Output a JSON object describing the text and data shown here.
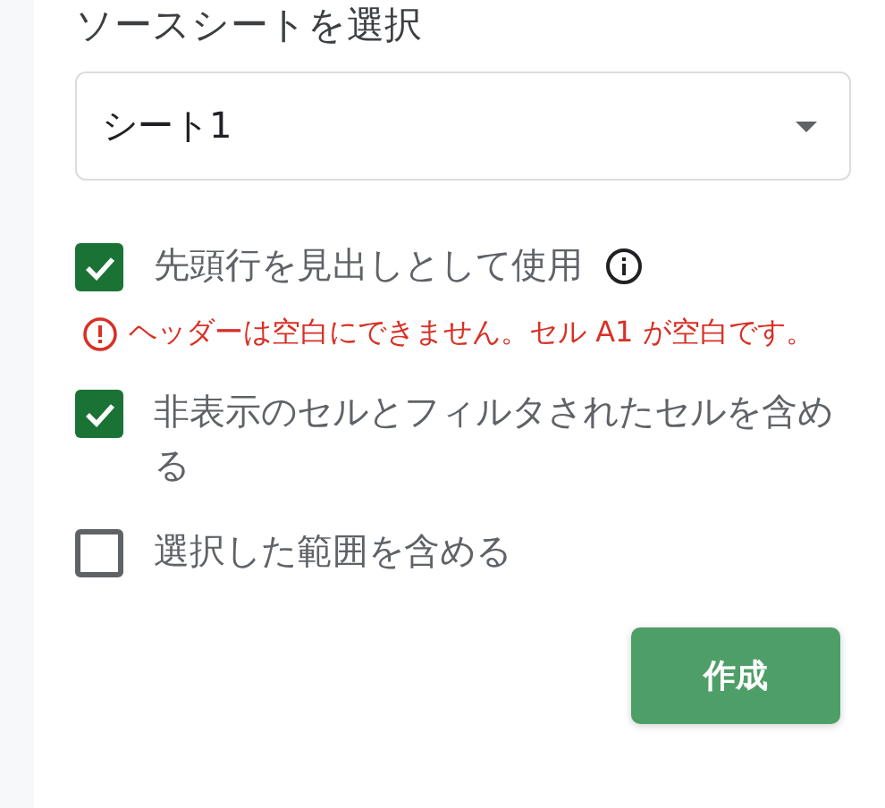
{
  "title": "ソースシートを選択",
  "sheet_select": {
    "value": "シート1"
  },
  "options": [
    {
      "label": "先頭行を見出しとして使用",
      "checked": true,
      "info_icon": true,
      "error": "ヘッダーは空白にできません。セル A1 が空白です。"
    },
    {
      "label": "非表示のセルとフィルタされたセルを含める",
      "checked": true,
      "info_icon": false
    },
    {
      "label": "選択した範囲を含める",
      "checked": false,
      "info_icon": false
    }
  ],
  "buttons": [
    {
      "label": "作成"
    }
  ]
}
